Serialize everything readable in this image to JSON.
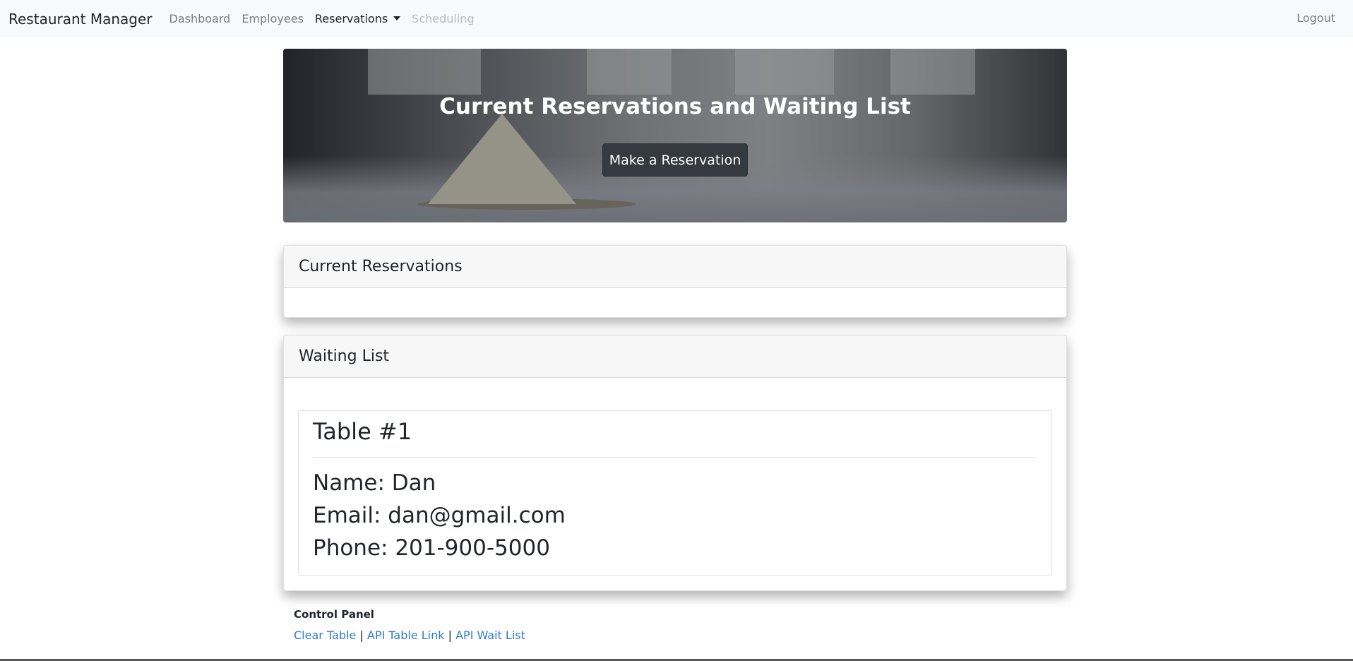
{
  "navbar": {
    "brand": "Restaurant Manager",
    "links": {
      "dashboard": "Dashboard",
      "employees": "Employees",
      "reservations": "Reservations",
      "scheduling": "Scheduling"
    },
    "logout": "Logout"
  },
  "hero": {
    "title": "Current Reservations and Waiting List",
    "button_label": "Make a Reservation"
  },
  "current_reservations": {
    "header": "Current Reservations"
  },
  "waiting_list": {
    "header": "Waiting List",
    "entries": [
      {
        "table": "Table #1",
        "name": "Name: Dan",
        "email": "Email: dan@gmail.com",
        "phone": "Phone: 201-900-5000"
      }
    ]
  },
  "control_panel": {
    "title": "Control Panel",
    "links": {
      "clear_table": "Clear Table",
      "api_table_link": "API Table Link",
      "api_wait_list": "API Wait List"
    },
    "separator": "|"
  },
  "colors": {
    "navbar_bg": "#f8f9fa",
    "button_dark": "#343a40",
    "link_blue": "#2f7bd0"
  }
}
